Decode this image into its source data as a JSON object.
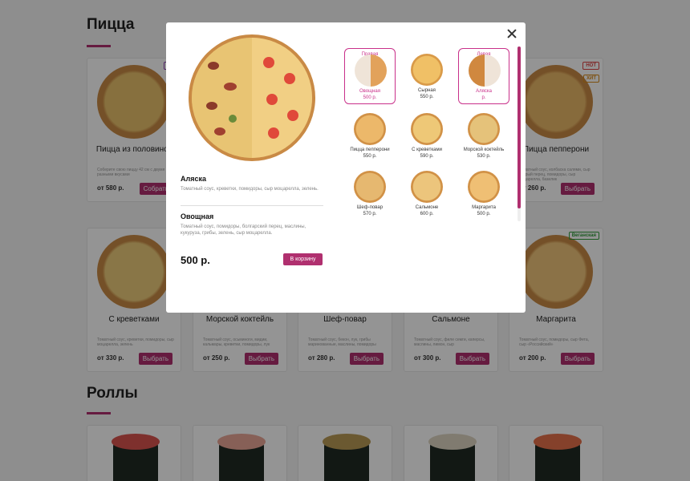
{
  "page": {
    "pizza_heading": "Пицца",
    "rolls_heading": "Роллы",
    "cards_row1": [
      {
        "name": "Пицца из половинок",
        "desc": "Соберите свою пиццу 42 см с двумя разными вкусами",
        "price": "от 580 р.",
        "button": "Собрать",
        "tag": "2 в"
      },
      {
        "name": "",
        "desc": "",
        "price": "",
        "button": ""
      },
      {
        "name": "",
        "desc": "",
        "price": "",
        "button": ""
      },
      {
        "name": "",
        "desc": "",
        "price": "",
        "button": ""
      },
      {
        "name": "Пицца пепперони",
        "desc": "Томатный соус, колбаска салями, сыр острый перец, помидоры, сыр моцарелла, базилик",
        "price": "от 260 р.",
        "button": "Выбрать",
        "tag": "HOT",
        "tag2": "ХИТ"
      }
    ],
    "cards_row2": [
      {
        "name": "С креветками",
        "desc": "Томатный соус, креветки, помидоры, сыр моцарелла, зелень",
        "price": "от 330 р.",
        "button": "Выбрать"
      },
      {
        "name": "Морской коктейль",
        "desc": "Томатный соус, осьминоги, мидии, кальмары, креветки, помидоры, лук",
        "price": "от 250 р.",
        "button": "Выбрать"
      },
      {
        "name": "Шеф-повар",
        "desc": "Томатный соус, бекон, лук, грибы маринованные, маслины, помидоры",
        "price": "от 280 р.",
        "button": "Выбрать"
      },
      {
        "name": "Сальмоне",
        "desc": "Томатный соус, филе семги, каперсы, маслины, лимон, сыр",
        "price": "от 300 р.",
        "button": "Выбрать"
      },
      {
        "name": "Маргарита",
        "desc": "Томатный соус, помидоры, сыр Фета, сыр «Российский»",
        "price": "от 200 р.",
        "button": "Выбрать",
        "tag": "Веганская"
      }
    ]
  },
  "modal": {
    "left_name": "Аляска",
    "left_desc": "Томатный соус, креветки, помидоры, сыр моцарелла, зелень.",
    "right_name": "Овощная",
    "right_desc": "Томатный соус, помидоры, болгарский перец, маслины, кукуруза, грибы, зелень, сыр моцарелла.",
    "total": "500 р.",
    "cart_button": "В корзину",
    "options": [
      {
        "name": "Овощная",
        "price": "500 р.",
        "tag": "Правая",
        "selected": true
      },
      {
        "name": "Сырная",
        "price": "550 р.",
        "tag": "",
        "selected": false
      },
      {
        "name": "Аляска",
        "price": "р.",
        "tag": "Левая",
        "selected": true
      },
      {
        "name": "Пицца пепперони",
        "price": "550 р.",
        "tag": "",
        "selected": false
      },
      {
        "name": "С креветками",
        "price": "590 р.",
        "tag": "",
        "selected": false
      },
      {
        "name": "Морской коктейль",
        "price": "530 р.",
        "tag": "",
        "selected": false
      },
      {
        "name": "Шеф-повар",
        "price": "570 р.",
        "tag": "",
        "selected": false
      },
      {
        "name": "Сальмоне",
        "price": "600 р.",
        "tag": "",
        "selected": false
      },
      {
        "name": "Маргарита",
        "price": "500 р.",
        "tag": "",
        "selected": false
      }
    ]
  },
  "colors": {
    "accent": "#b0306f",
    "selected_border": "#c9308a"
  }
}
